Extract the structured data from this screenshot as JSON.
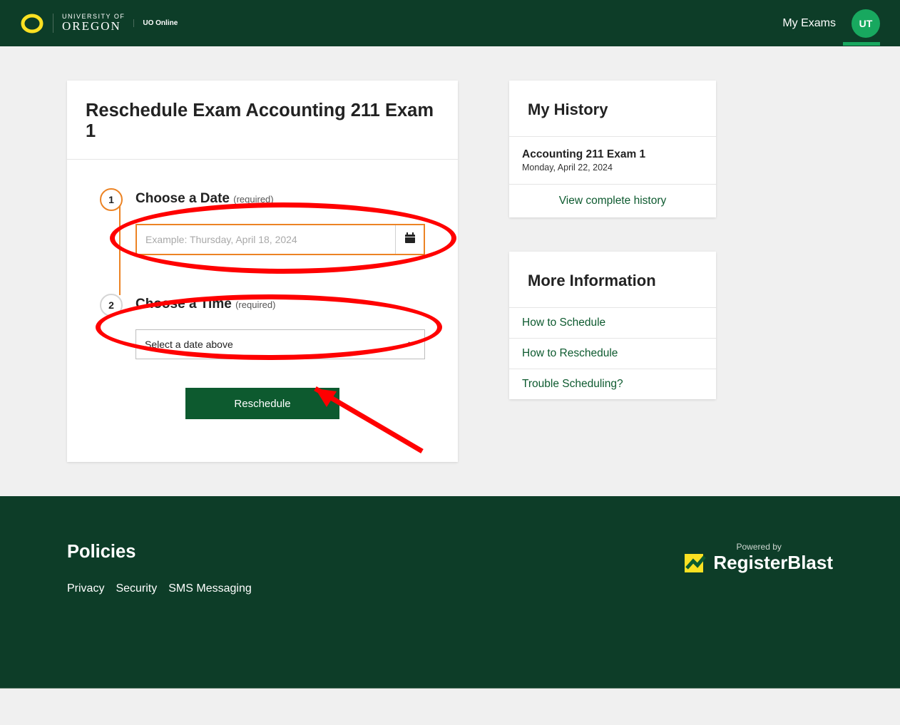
{
  "header": {
    "logo_university": "UNIVERSITY OF",
    "logo_oregon": "OREGON",
    "uo_online": "UO Online",
    "my_exams": "My Exams",
    "avatar_initials": "UT"
  },
  "main": {
    "title": "Reschedule Exam Accounting 211 Exam 1",
    "step1": {
      "num": "1",
      "label": "Choose a Date",
      "required": "(required)"
    },
    "date_placeholder": "Example: Thursday, April 18, 2024",
    "step2": {
      "num": "2",
      "label": "Choose a Time",
      "required": "(required)"
    },
    "time_placeholder": "Select a date above",
    "reschedule_btn": "Reschedule"
  },
  "history": {
    "title": "My History",
    "items": [
      {
        "title": "Accounting 211 Exam 1",
        "date": "Monday, April 22, 2024"
      }
    ],
    "view_all": "View complete history"
  },
  "more_info": {
    "title": "More Information",
    "links": [
      "How to Schedule",
      "How to Reschedule",
      "Trouble Scheduling?"
    ]
  },
  "footer": {
    "policies_title": "Policies",
    "links": [
      "Privacy",
      "Security",
      "SMS Messaging"
    ],
    "powered_by": "Powered by",
    "brand": "RegisterBlast"
  }
}
